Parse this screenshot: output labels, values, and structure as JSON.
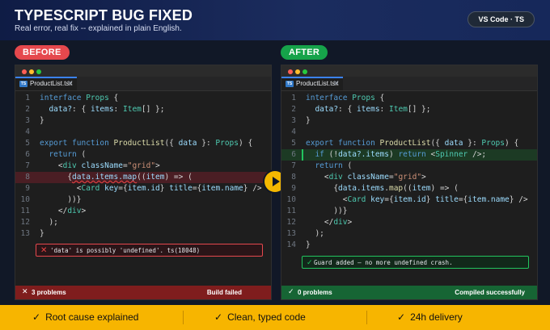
{
  "header": {
    "title": "TYPESCRIPT BUG FIXED",
    "subtitle": "Real error, real fix -- explained in plain English.",
    "chip": "VS Code · TS"
  },
  "before": {
    "label": "BEFORE",
    "tab": {
      "badge": "TS",
      "filename": "ProductList.tsx",
      "close": "✕"
    },
    "lines": [
      {
        "n": "1",
        "tokens": [
          [
            "k",
            "interface "
          ],
          [
            "ty",
            "Props"
          ],
          [
            "pu",
            " {"
          ]
        ]
      },
      {
        "n": "2",
        "tokens": [
          [
            "pr",
            "  data?"
          ],
          [
            "pu",
            ": { "
          ],
          [
            "pr",
            "items"
          ],
          [
            "pu",
            ": "
          ],
          [
            "ty",
            "Item"
          ],
          [
            "pu",
            "[] };"
          ]
        ]
      },
      {
        "n": "3",
        "tokens": [
          [
            "pu",
            "}"
          ]
        ]
      },
      {
        "n": "4",
        "tokens": []
      },
      {
        "n": "5",
        "tokens": [
          [
            "k",
            "export function "
          ],
          [
            "fn",
            "ProductList"
          ],
          [
            "pu",
            "({ "
          ],
          [
            "pr",
            "data"
          ],
          [
            "pu",
            " }: "
          ],
          [
            "ty",
            "Props"
          ],
          [
            "pu",
            ") {"
          ]
        ]
      },
      {
        "n": "6",
        "tokens": [
          [
            "k",
            "  return"
          ],
          [
            "pu",
            " ("
          ]
        ]
      },
      {
        "n": "7",
        "tokens": [
          [
            "pu",
            "    <"
          ],
          [
            "tg",
            "div"
          ],
          [
            "pr",
            " className"
          ],
          [
            "pu",
            "="
          ],
          [
            "st",
            "\"grid\""
          ],
          [
            "pu",
            ">"
          ]
        ]
      },
      {
        "n": "8",
        "err": true,
        "tokens": [
          [
            "pu",
            "      {"
          ],
          [
            "sq",
            "data.items.map"
          ],
          [
            "pu",
            "(("
          ],
          [
            "pr",
            "item"
          ],
          [
            "pu",
            ") => ("
          ]
        ]
      },
      {
        "n": "9",
        "tokens": [
          [
            "pu",
            "        <"
          ],
          [
            "tg",
            "Card"
          ],
          [
            "pr",
            " key"
          ],
          [
            "pu",
            "={"
          ],
          [
            "pr",
            "item.id"
          ],
          [
            "pu",
            "} "
          ],
          [
            "pr",
            "title"
          ],
          [
            "pu",
            "={"
          ],
          [
            "pr",
            "item.name"
          ],
          [
            "pu",
            "} />"
          ]
        ]
      },
      {
        "n": "10",
        "tokens": [
          [
            "pu",
            "      ))}"
          ]
        ]
      },
      {
        "n": "11",
        "tokens": [
          [
            "pu",
            "    </"
          ],
          [
            "tg",
            "div"
          ],
          [
            "pu",
            ">"
          ]
        ]
      },
      {
        "n": "12",
        "tokens": [
          [
            "pu",
            "  );"
          ]
        ]
      },
      {
        "n": "13",
        "tokens": [
          [
            "pu",
            "}"
          ]
        ]
      }
    ],
    "error_icon": "✕",
    "error_message": "'data' is possibly 'undefined'. ts(18048)",
    "status": {
      "icon": "✕",
      "left": "3 problems",
      "right": "Build failed"
    }
  },
  "after": {
    "label": "AFTER",
    "tab": {
      "badge": "TS",
      "filename": "ProductList.tsx",
      "close": "✕"
    },
    "lines": [
      {
        "n": "1",
        "tokens": [
          [
            "k",
            "interface "
          ],
          [
            "ty",
            "Props"
          ],
          [
            "pu",
            " {"
          ]
        ]
      },
      {
        "n": "2",
        "tokens": [
          [
            "pr",
            "  data?"
          ],
          [
            "pu",
            ": { "
          ],
          [
            "pr",
            "items"
          ],
          [
            "pu",
            ": "
          ],
          [
            "ty",
            "Item"
          ],
          [
            "pu",
            "[] };"
          ]
        ]
      },
      {
        "n": "3",
        "tokens": [
          [
            "pu",
            "}"
          ]
        ]
      },
      {
        "n": "4",
        "tokens": []
      },
      {
        "n": "5",
        "tokens": [
          [
            "k",
            "export function "
          ],
          [
            "fn",
            "ProductList"
          ],
          [
            "pu",
            "({ "
          ],
          [
            "pr",
            "data"
          ],
          [
            "pu",
            " }: "
          ],
          [
            "ty",
            "Props"
          ],
          [
            "pu",
            ") {"
          ]
        ]
      },
      {
        "n": "6",
        "add": true,
        "tokens": [
          [
            "k",
            "  if"
          ],
          [
            "pu",
            " (!"
          ],
          [
            "pr",
            "data?.items"
          ],
          [
            "pu",
            ") "
          ],
          [
            "k",
            "return"
          ],
          [
            "pu",
            " <"
          ],
          [
            "tg",
            "Spinner"
          ],
          [
            "pu",
            " />;"
          ]
        ]
      },
      {
        "n": "7",
        "tokens": [
          [
            "k",
            "  return"
          ],
          [
            "pu",
            " ("
          ]
        ]
      },
      {
        "n": "8",
        "tokens": [
          [
            "pu",
            "    <"
          ],
          [
            "tg",
            "div"
          ],
          [
            "pr",
            " className"
          ],
          [
            "pu",
            "="
          ],
          [
            "st",
            "\"grid\""
          ],
          [
            "pu",
            ">"
          ]
        ]
      },
      {
        "n": "9",
        "tokens": [
          [
            "pu",
            "      {"
          ],
          [
            "pr",
            "data.items"
          ],
          [
            "pu",
            "."
          ],
          [
            "fn",
            "map"
          ],
          [
            "pu",
            "(("
          ],
          [
            "pr",
            "item"
          ],
          [
            "pu",
            ") => ("
          ]
        ]
      },
      {
        "n": "10",
        "tokens": [
          [
            "pu",
            "        <"
          ],
          [
            "tg",
            "Card"
          ],
          [
            "pr",
            " key"
          ],
          [
            "pu",
            "={"
          ],
          [
            "pr",
            "item.id"
          ],
          [
            "pu",
            "} "
          ],
          [
            "pr",
            "title"
          ],
          [
            "pu",
            "={"
          ],
          [
            "pr",
            "item.name"
          ],
          [
            "pu",
            "} />"
          ]
        ]
      },
      {
        "n": "11",
        "tokens": [
          [
            "pu",
            "      ))}"
          ]
        ]
      },
      {
        "n": "12",
        "tokens": [
          [
            "pu",
            "    </"
          ],
          [
            "tg",
            "div"
          ],
          [
            "pu",
            ">"
          ]
        ]
      },
      {
        "n": "13",
        "tokens": [
          [
            "pu",
            "  );"
          ]
        ]
      },
      {
        "n": "14",
        "tokens": [
          [
            "pu",
            "}"
          ]
        ]
      }
    ],
    "ok_icon": "✓",
    "ok_message": "Guard added — no more undefined crash.",
    "status": {
      "icon": "✓",
      "left": "0 problems",
      "right": "Compiled successfully"
    }
  },
  "features": [
    {
      "icon": "✓",
      "label": "Root cause explained"
    },
    {
      "icon": "✓",
      "label": "Clean, typed code"
    },
    {
      "icon": "✓",
      "label": "24h delivery"
    }
  ],
  "colors": {
    "before_accent": "#e5484d",
    "after_accent": "#16a34a",
    "feature_bar": "#f7b500",
    "arrow": "#f5b800"
  }
}
